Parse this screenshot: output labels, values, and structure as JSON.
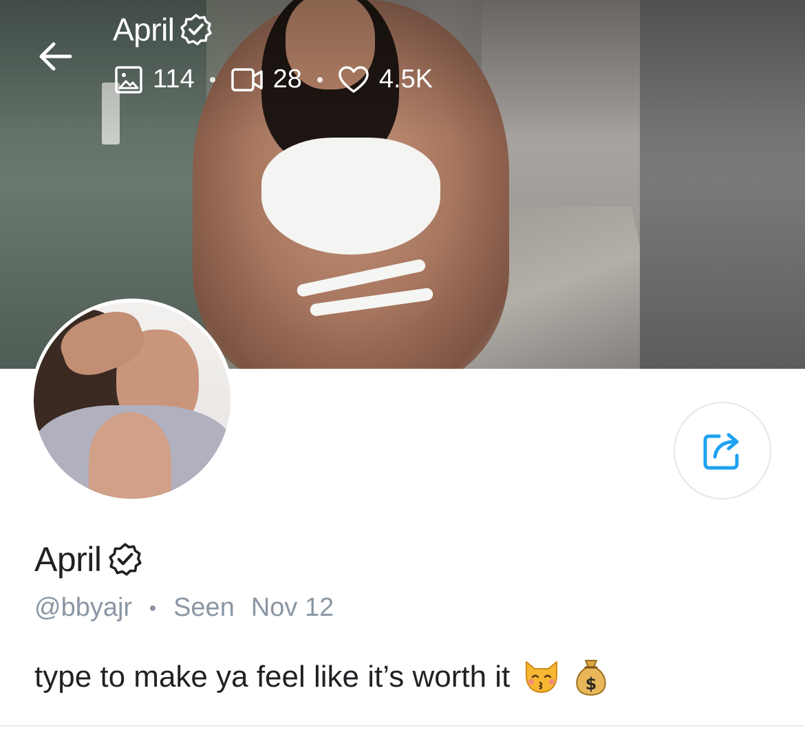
{
  "header": {
    "name": "April",
    "stats": {
      "photos": "114",
      "videos": "28",
      "likes": "4.5K"
    }
  },
  "profile": {
    "name": "April",
    "handle": "@bbyajr",
    "seen_label": "Seen",
    "seen_date": "Nov 12",
    "bio": "type to make ya feel like it’s worth it"
  },
  "icons": {
    "back": "arrow-left-icon",
    "verified": "verified-badge-icon",
    "photos": "image-icon",
    "videos": "video-icon",
    "likes": "heart-icon",
    "share": "share-icon",
    "bio_emoji_1": "kissing-cat-emoji",
    "bio_emoji_2": "money-bag-emoji"
  },
  "colors": {
    "accent": "#1da1f2",
    "text_primary": "#1f2124",
    "text_secondary": "#8a96a3"
  }
}
